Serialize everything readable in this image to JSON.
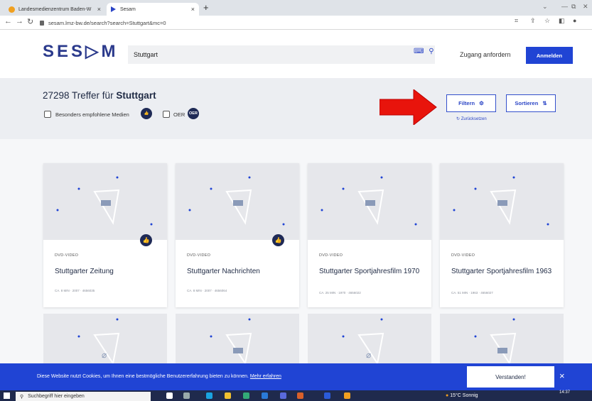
{
  "browser": {
    "tab1_title": "Landesmedienzentrum Baden-W",
    "tab2_title": "Sesam",
    "tab_close": "×",
    "new_tab": "+",
    "url": "sesam.lmz-bw.de/search?search=Stuttgart&mc=0"
  },
  "site": {
    "logo": "SES▷M",
    "search_value": "Stuttgart",
    "zugang": "Zugang anfordern",
    "anmelden": "Anmelden"
  },
  "results": {
    "count": "27298 Treffer für",
    "query": "Stuttgart",
    "besonders": "Besonders empfohlene Medien",
    "oer": "OER",
    "oer_badge": "OER",
    "filter": "Filtern",
    "sortieren": "Sortieren",
    "reset": "Zurücksetzen"
  },
  "cards": [
    {
      "type": "DVD-VIDEO",
      "title": "Stuttgarter Zeitung",
      "meta": "CA. 8 MIN · 2007 · 4656035"
    },
    {
      "type": "DVD-VIDEO",
      "title": "Stuttgarter Nachrichten",
      "meta": "CA. 8 MIN · 2007 · 4656064"
    },
    {
      "type": "DVD-VIDEO",
      "title": "Stuttgarter Sportjahresfilm 1970",
      "meta": "CA. 25 MIN · 1970 · 4656022"
    },
    {
      "type": "DVD-VIDEO",
      "title": "Stuttgarter Sportjahresfilm 1963",
      "meta": "CA. 51 MIN · 1963 · 4656027"
    }
  ],
  "cookie": {
    "text": "Diese Website nutzt Cookies, um Ihnen eine bestmögliche Benutzererfahrung bieten zu können.",
    "link": "Mehr erfahren",
    "button": "Verstanden!",
    "close": "×"
  },
  "taskbar": {
    "search_placeholder": "Suchbegriff hier eingeben",
    "weather": "15°C Sonnig",
    "time": "14:37"
  },
  "colors": {
    "primary": "#2044d4",
    "navy": "#1f2a56",
    "arrow": "#e8140c"
  }
}
